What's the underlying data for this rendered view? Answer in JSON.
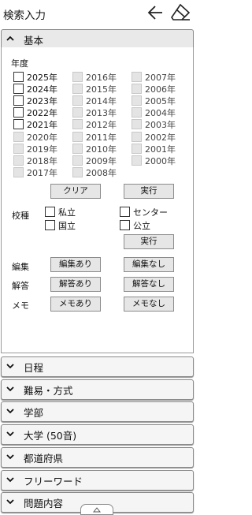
{
  "header": {
    "title": "検索入力",
    "back_icon": "arrow-left-icon",
    "clear_icon": "eraser-icon"
  },
  "basic": {
    "label": "基本",
    "year_label": "年度",
    "years": [
      {
        "label": "2025年",
        "enabled": true
      },
      {
        "label": "2016年",
        "enabled": false
      },
      {
        "label": "2007年",
        "enabled": false
      },
      {
        "label": "2024年",
        "enabled": true
      },
      {
        "label": "2015年",
        "enabled": false
      },
      {
        "label": "2006年",
        "enabled": false
      },
      {
        "label": "2023年",
        "enabled": true
      },
      {
        "label": "2014年",
        "enabled": false
      },
      {
        "label": "2005年",
        "enabled": false
      },
      {
        "label": "2022年",
        "enabled": true
      },
      {
        "label": "2013年",
        "enabled": false
      },
      {
        "label": "2004年",
        "enabled": false
      },
      {
        "label": "2021年",
        "enabled": true
      },
      {
        "label": "2012年",
        "enabled": false
      },
      {
        "label": "2003年",
        "enabled": false
      },
      {
        "label": "2020年",
        "enabled": false
      },
      {
        "label": "2011年",
        "enabled": false
      },
      {
        "label": "2002年",
        "enabled": false
      },
      {
        "label": "2019年",
        "enabled": false
      },
      {
        "label": "2010年",
        "enabled": false
      },
      {
        "label": "2001年",
        "enabled": false
      },
      {
        "label": "2018年",
        "enabled": false
      },
      {
        "label": "2009年",
        "enabled": false
      },
      {
        "label": "2000年",
        "enabled": false
      },
      {
        "label": "2017年",
        "enabled": false
      },
      {
        "label": "2008年",
        "enabled": false
      }
    ],
    "clear_button": "クリア",
    "run_button": "実行",
    "school_type_label": "校種",
    "school_types": [
      "私立",
      "センター",
      "国立",
      "公立"
    ],
    "school_run_button": "実行",
    "edit_label": "編集",
    "edit_yes": "編集あり",
    "edit_no": "編集なし",
    "answer_label": "解答",
    "answer_yes": "解答あり",
    "answer_no": "解答なし",
    "memo_label": "メモ",
    "memo_yes": "メモあり",
    "memo_no": "メモなし"
  },
  "sections": [
    "日程",
    "難易・方式",
    "学部",
    "大学 (50音)",
    "都道府県",
    "フリーワード",
    "問題内容"
  ]
}
